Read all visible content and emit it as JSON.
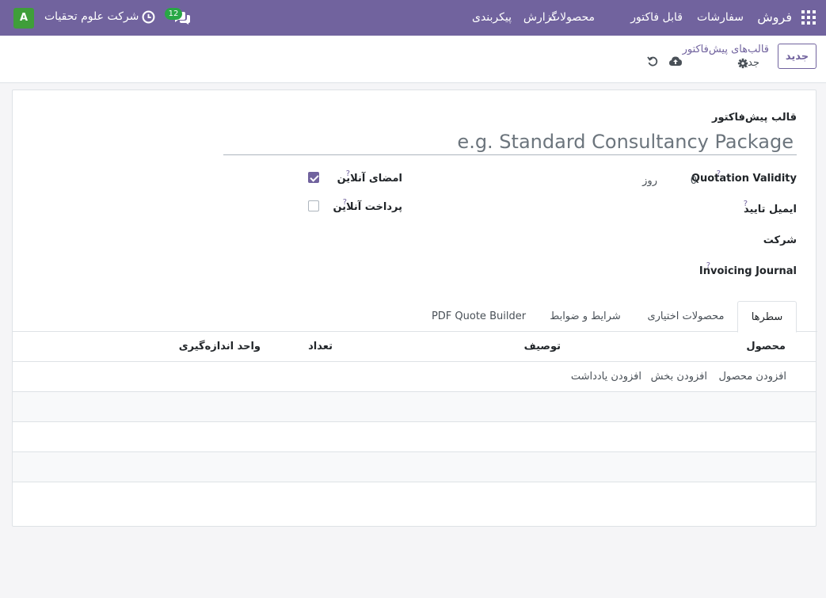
{
  "navbar": {
    "app_name": "فروش",
    "menu": [
      {
        "label": "سفارشات"
      },
      {
        "label": "قابل فاکتور"
      },
      {
        "label": "محصولات"
      },
      {
        "label": "گزارش"
      },
      {
        "label": "پیکربندی"
      }
    ],
    "company": "شرکت علوم تحقیات",
    "avatar_letter": "A",
    "messages_count": "12"
  },
  "control_panel": {
    "new_button": "جدید",
    "breadcrumb": "قالب‌های پیش‌فاکتور",
    "record_name": "جدید"
  },
  "form": {
    "name_label": "قالب پیش‌فاکتور",
    "name_placeholder": "e.g. Standard Consultancy Package",
    "fields": {
      "quotation_validity": {
        "label": "Quotation Validity",
        "value": "0",
        "unit": "روز"
      },
      "confirmation_email": {
        "label": "ایمیل تایید"
      },
      "company": {
        "label": "شرکت"
      },
      "invoicing_journal": {
        "label": "Invoicing Journal"
      },
      "online_signature": {
        "label": "امضای آنلاین",
        "checked": true
      },
      "online_payment": {
        "label": "پرداخت آنلاین",
        "checked": false
      }
    },
    "help_mark": "?"
  },
  "tabs": [
    {
      "label": "سطرها",
      "active": true
    },
    {
      "label": "محصولات اختیاری",
      "active": false
    },
    {
      "label": "شرایط و ضوابط",
      "active": false
    },
    {
      "label": "PDF Quote Builder",
      "active": false
    }
  ],
  "table": {
    "columns": [
      "محصول",
      "توصیف",
      "تعداد",
      "واحد اندازه‌گیری"
    ],
    "add_links": [
      "افزودن محصول",
      "افزودن بخش",
      "افزودن یادداشت"
    ]
  },
  "colors": {
    "brand": "#71639e",
    "badge": "#28a745",
    "avatar": "#3f9e3a"
  }
}
